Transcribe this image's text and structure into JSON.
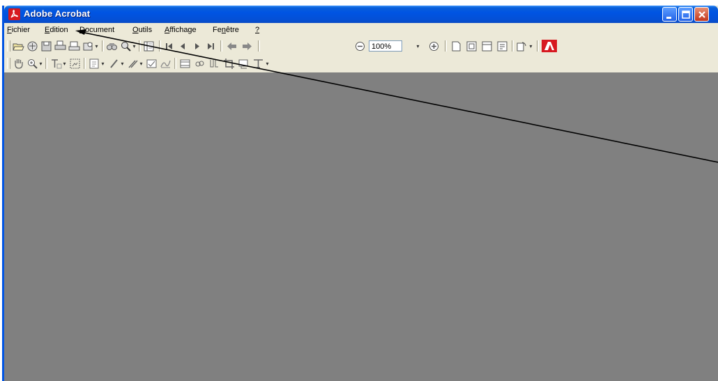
{
  "window": {
    "title": "Adobe Acrobat"
  },
  "menu": [
    "Fichier",
    "Edition",
    "Document",
    "Outils",
    "Affichage",
    "Fenêtre",
    "?"
  ],
  "menu_mnemonic_index": [
    0,
    0,
    0,
    0,
    0,
    2,
    0
  ],
  "toolbar": {
    "zoom_value": "100%"
  },
  "icons": [
    "open-icon",
    "email-icon",
    "save-icon",
    "print-icon",
    "print-setup-icon",
    "ebook-icon",
    "find-icon",
    "search-icon",
    "navigation-pane-icon",
    "first-page-icon",
    "previous-page-icon",
    "next-page-icon",
    "last-page-icon",
    "go-back-icon",
    "go-forward-icon",
    "zoom-out-icon",
    "zoom-in-icon",
    "actual-size-icon",
    "fit-page-icon",
    "fit-width-icon",
    "reflow-icon",
    "rotate-icon",
    "adobe-logo-icon",
    "hand-tool-icon",
    "zoom-tool-icon",
    "text-select-icon",
    "graphics-select-icon",
    "note-tool-icon",
    "pencil-tool-icon",
    "highlight-tool-icon",
    "form-tool-icon",
    "signature-tool-icon",
    "movie-tool-icon",
    "link-tool-icon",
    "article-tool-icon",
    "crop-tool-icon",
    "touchup-object-icon",
    "touchup-text-icon"
  ],
  "colors": {
    "titlebar": "#0054e3",
    "workspace": "#808080",
    "chrome": "#ece9d8",
    "adobe_red": "#d71920"
  }
}
